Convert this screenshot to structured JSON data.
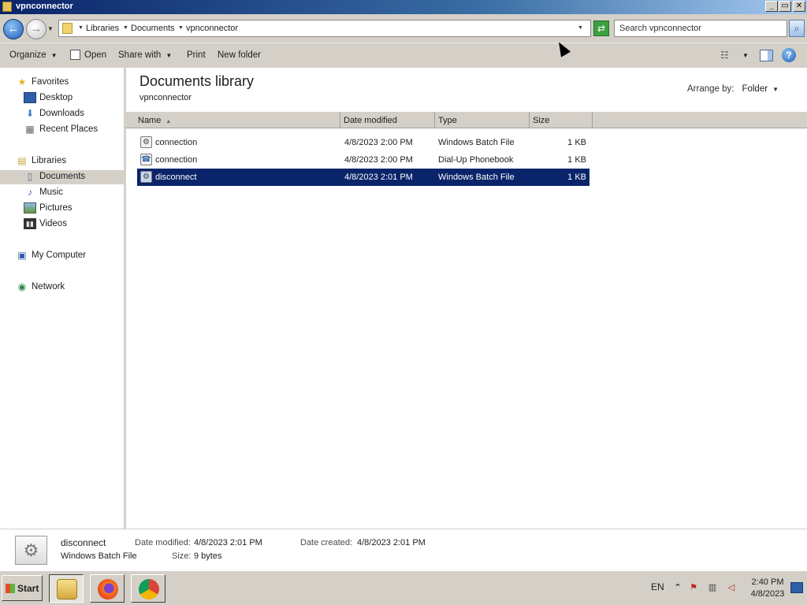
{
  "window": {
    "title": "vpnconnector",
    "min_label": "_",
    "max_label": "▭",
    "close_label": "✕"
  },
  "address": {
    "crumbs": [
      "Libraries",
      "Documents",
      "vpnconnector"
    ],
    "search_placeholder": "Search vpnconnector"
  },
  "toolbar": {
    "organize": "Organize",
    "open": "Open",
    "share_with": "Share with",
    "print": "Print",
    "new_folder": "New folder"
  },
  "sidebar": {
    "favorites": "Favorites",
    "desktop": "Desktop",
    "downloads": "Downloads",
    "recent_places": "Recent Places",
    "libraries": "Libraries",
    "documents": "Documents",
    "music": "Music",
    "pictures": "Pictures",
    "videos": "Videos",
    "my_computer": "My Computer",
    "network": "Network"
  },
  "library": {
    "title": "Documents library",
    "subtitle": "vpnconnector",
    "arrange_by_label": "Arrange by:",
    "arrange_by_value": "Folder"
  },
  "columns": {
    "name": "Name",
    "date_modified": "Date modified",
    "type": "Type",
    "size": "Size"
  },
  "files": [
    {
      "name": "connection",
      "date": "4/8/2023 2:00 PM",
      "type": "Windows Batch File",
      "size": "1 KB",
      "icon": "batch-file-icon",
      "selected": false
    },
    {
      "name": "connection",
      "date": "4/8/2023 2:00 PM",
      "type": "Dial-Up Phonebook",
      "size": "1 KB",
      "icon": "phonebook-icon",
      "selected": false
    },
    {
      "name": "disconnect",
      "date": "4/8/2023 2:01 PM",
      "type": "Windows Batch File",
      "size": "1 KB",
      "icon": "batch-file-icon",
      "selected": true
    }
  ],
  "details": {
    "name": "disconnect",
    "type": "Windows Batch File",
    "date_modified_label": "Date modified:",
    "date_modified": "4/8/2023 2:01 PM",
    "date_created_label": "Date created:",
    "date_created": "4/8/2023 2:01 PM",
    "size_label": "Size:",
    "size": "9 bytes"
  },
  "taskbar": {
    "start": "Start",
    "language": "EN",
    "time": "2:40 PM",
    "date": "4/8/2023"
  },
  "colors": {
    "selection": "#0a246a",
    "chrome": "#d4d0c8"
  }
}
